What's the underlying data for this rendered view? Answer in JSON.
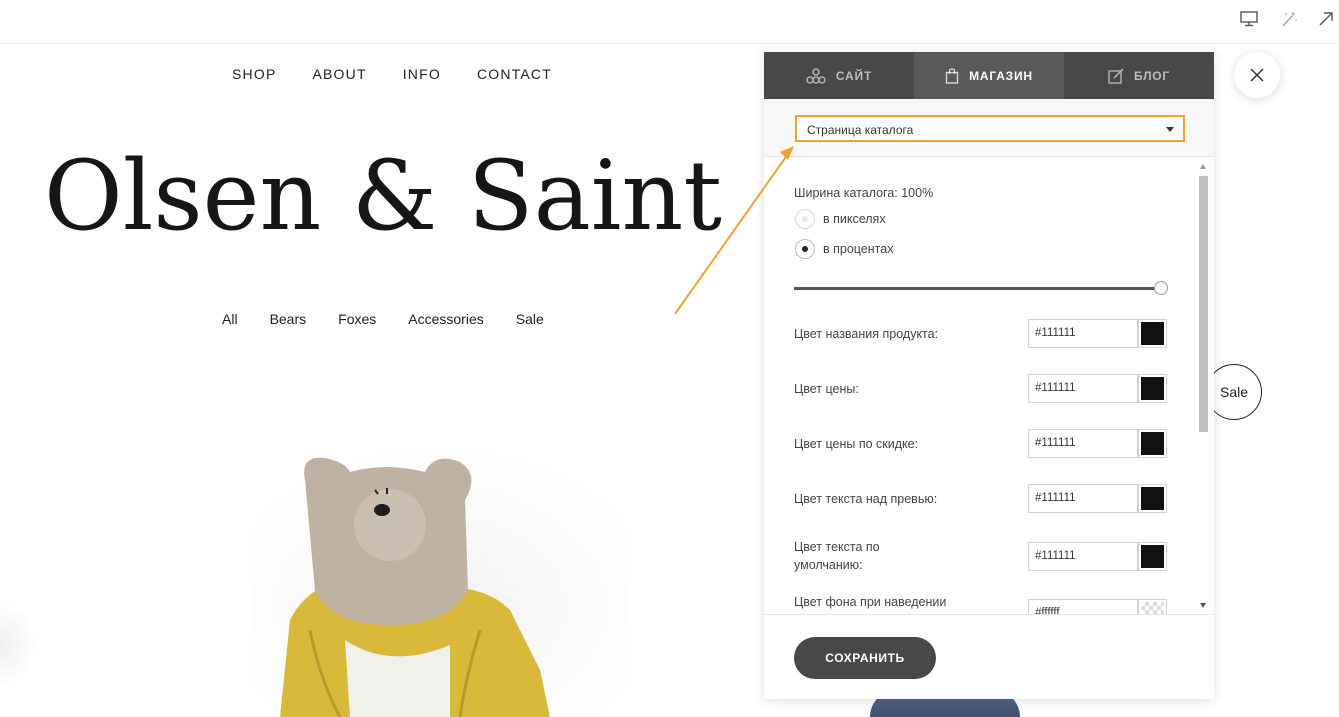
{
  "toolbar": {
    "icons": [
      "desktop-icon",
      "magic-wand-icon",
      "external-arrow-icon"
    ]
  },
  "site": {
    "nav": [
      "SHOP",
      "ABOUT",
      "INFO",
      "CONTACT"
    ],
    "brand": "Olsen & Saint",
    "categories": [
      "All",
      "Bears",
      "Foxes",
      "Accessories",
      "Sale"
    ],
    "sale_badge": "Sale"
  },
  "panel": {
    "tabs": [
      {
        "label": "САЙТ",
        "icon": "molecule-icon",
        "active": false
      },
      {
        "label": "МАГАЗИН",
        "icon": "shopping-bag-icon",
        "active": true
      },
      {
        "label": "БЛОГ",
        "icon": "edit-icon",
        "active": false
      }
    ],
    "page_select": "Страница каталога",
    "catalog_width_label": "Ширина каталога: 100%",
    "width_unit_options": [
      {
        "label": "в пикселях",
        "selected": false
      },
      {
        "label": "в процентах",
        "selected": true
      }
    ],
    "width_slider_value": 1.0,
    "colors": [
      {
        "name": "Цвет названия продукта:",
        "value": "#111111",
        "swatch": "#111111"
      },
      {
        "name": "Цвет цены:",
        "value": "#111111",
        "swatch": "#111111"
      },
      {
        "name": "Цвет цены по скидке:",
        "value": "#111111",
        "swatch": "#111111"
      },
      {
        "name": "Цвет текста над превью:",
        "value": "#111111",
        "swatch": "#111111"
      },
      {
        "name": "Цвет текста по умолчанию:",
        "value": "#111111",
        "swatch": "#111111"
      },
      {
        "name": "Цвет фона при наведении",
        "value": "#ffffff",
        "swatch": "transparent"
      }
    ],
    "save_label": "СОХРАНИТЬ"
  },
  "theme": {
    "accent": "#f0a037",
    "tab_bg": "#484848",
    "tab_active_bg": "#5a5a5a"
  }
}
